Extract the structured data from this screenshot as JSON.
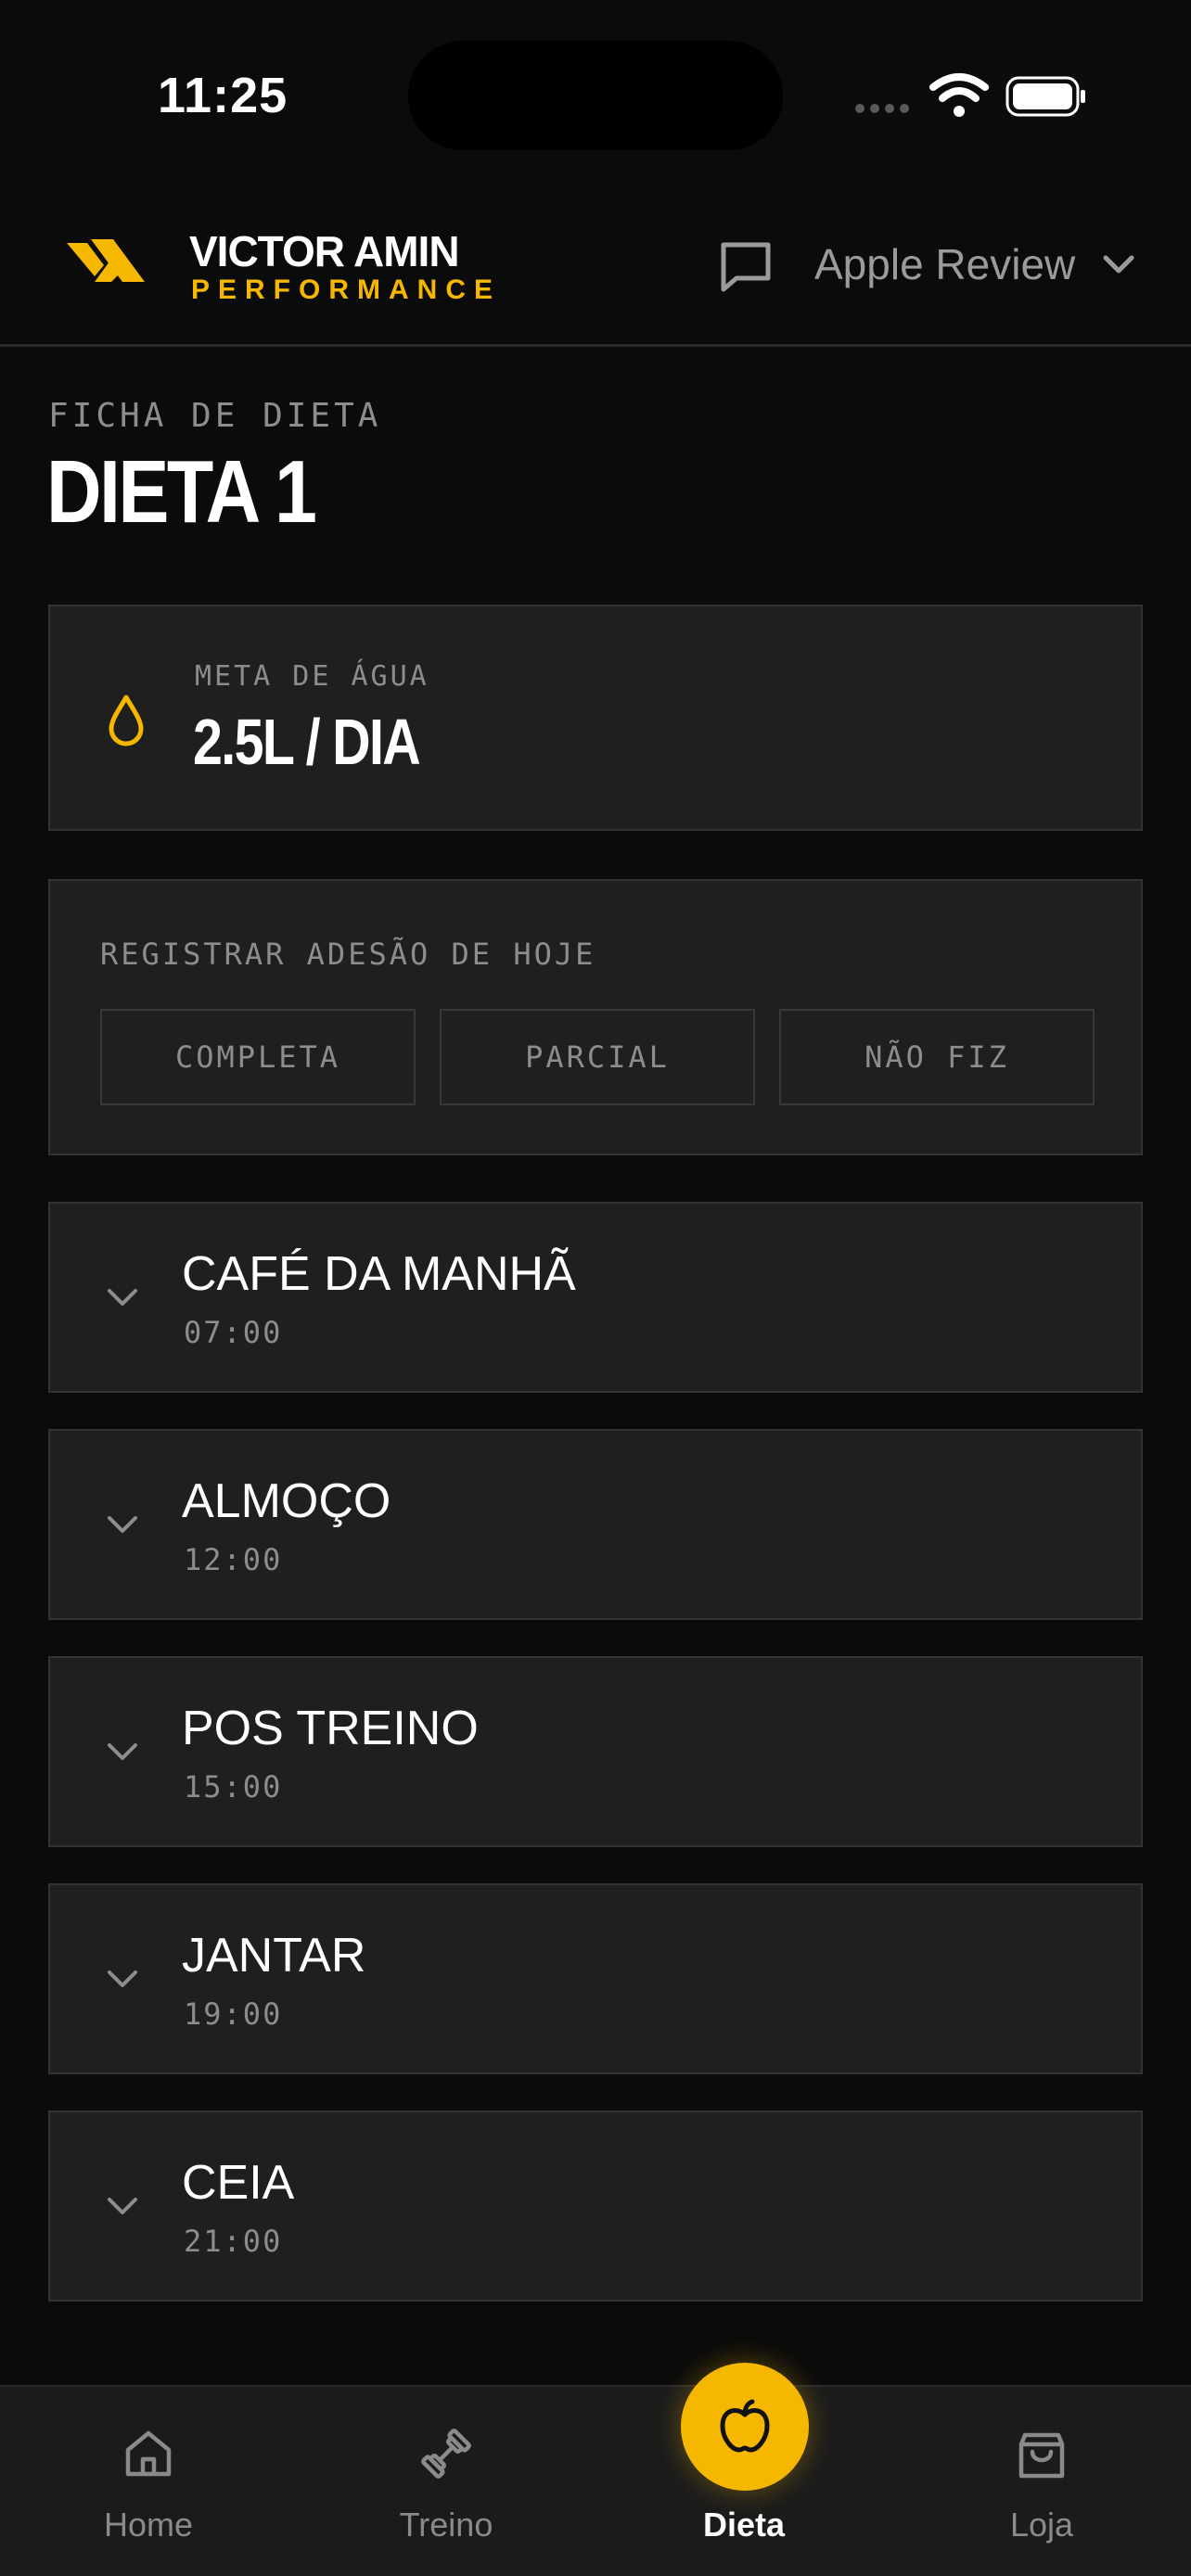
{
  "status": {
    "time": "11:25"
  },
  "header": {
    "brand_name": "VICTOR AMIN",
    "brand_sub": "PERFORMANCE",
    "user_name": "Apple Review"
  },
  "page": {
    "kicker": "FICHA DE DIETA",
    "title": "DIETA 1"
  },
  "water": {
    "label": "META DE ÁGUA",
    "value": "2.5L / DIA"
  },
  "adherence": {
    "label": "REGISTRAR ADESÃO DE HOJE",
    "buttons": [
      "COMPLETA",
      "PARCIAL",
      "NÃO FIZ"
    ]
  },
  "meals": [
    {
      "name": "CAFÉ DA MANHÃ",
      "time": "07:00"
    },
    {
      "name": "ALMOÇO",
      "time": "12:00"
    },
    {
      "name": "POS TREINO",
      "time": "15:00"
    },
    {
      "name": "JANTAR",
      "time": "19:00"
    },
    {
      "name": "CEIA",
      "time": "21:00"
    }
  ],
  "tabs": [
    {
      "label": "Home",
      "icon": "home-icon"
    },
    {
      "label": "Treino",
      "icon": "dumbbell-icon"
    },
    {
      "label": "Dieta",
      "icon": "apple-icon",
      "active": true
    },
    {
      "label": "Loja",
      "icon": "shopping-bag-icon"
    }
  ],
  "colors": {
    "accent": "#f5b700",
    "background": "#0b0b0b",
    "card": "#1f1f1f"
  }
}
